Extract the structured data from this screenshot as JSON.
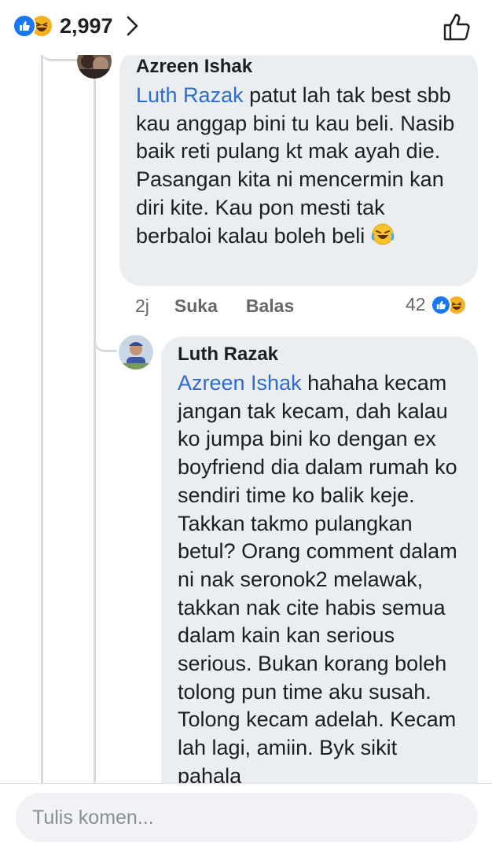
{
  "header": {
    "reaction_count": "2,997",
    "icons": [
      "like-icon",
      "haha-icon",
      "chevron-right-icon",
      "thumbs-up-outline-icon"
    ]
  },
  "comments": [
    {
      "author": "Azreen Ishak",
      "mention": "Luth Razak",
      "text": " patut lah tak best sbb kau anggap bini tu kau beli. Nasib baik reti pulang kt mak ayah die. Pasangan kita ni mencermin kan diri kite. Kau pon mesti tak berbaloi kalau boleh beli",
      "emoji": "🤣",
      "time": "2j",
      "like_label": "Suka",
      "reply_label": "Balas",
      "reactions": "42"
    },
    {
      "author": "Luth Razak",
      "mention": "Azreen Ishak",
      "text": " hahaha kecam jangan tak kecam, dah kalau ko jumpa bini ko dengan ex boyfriend dia dalam rumah ko sendiri time ko balik keje. Takkan takmo pulangkan betul? Orang comment dalam ni nak seronok2 melawak, takkan nak cite habis semua dalam kain kan serious serious. Bukan korang boleh tolong pun time aku susah. Tolong kecam adelah. Kecam lah lagi, amiin. Byk sikit pahala"
    }
  ],
  "composer": {
    "placeholder": "Tulis komen..."
  },
  "colors": {
    "mention": "#2d6ccb",
    "bubble": "#ebeef0",
    "like_blue": "#1877f2",
    "haha_yellow": "#f7b125"
  }
}
